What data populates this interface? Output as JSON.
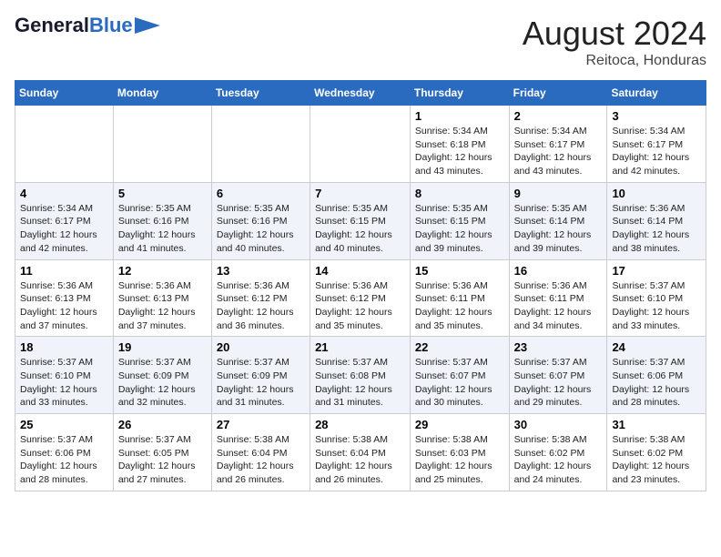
{
  "header": {
    "logo_line1": "General",
    "logo_line2": "Blue",
    "month": "August 2024",
    "location": "Reitoca, Honduras"
  },
  "days_of_week": [
    "Sunday",
    "Monday",
    "Tuesday",
    "Wednesday",
    "Thursday",
    "Friday",
    "Saturday"
  ],
  "weeks": [
    [
      {
        "day": "",
        "info": ""
      },
      {
        "day": "",
        "info": ""
      },
      {
        "day": "",
        "info": ""
      },
      {
        "day": "",
        "info": ""
      },
      {
        "day": "1",
        "info": "Sunrise: 5:34 AM\nSunset: 6:18 PM\nDaylight: 12 hours\nand 43 minutes."
      },
      {
        "day": "2",
        "info": "Sunrise: 5:34 AM\nSunset: 6:17 PM\nDaylight: 12 hours\nand 43 minutes."
      },
      {
        "day": "3",
        "info": "Sunrise: 5:34 AM\nSunset: 6:17 PM\nDaylight: 12 hours\nand 42 minutes."
      }
    ],
    [
      {
        "day": "4",
        "info": "Sunrise: 5:34 AM\nSunset: 6:17 PM\nDaylight: 12 hours\nand 42 minutes."
      },
      {
        "day": "5",
        "info": "Sunrise: 5:35 AM\nSunset: 6:16 PM\nDaylight: 12 hours\nand 41 minutes."
      },
      {
        "day": "6",
        "info": "Sunrise: 5:35 AM\nSunset: 6:16 PM\nDaylight: 12 hours\nand 40 minutes."
      },
      {
        "day": "7",
        "info": "Sunrise: 5:35 AM\nSunset: 6:15 PM\nDaylight: 12 hours\nand 40 minutes."
      },
      {
        "day": "8",
        "info": "Sunrise: 5:35 AM\nSunset: 6:15 PM\nDaylight: 12 hours\nand 39 minutes."
      },
      {
        "day": "9",
        "info": "Sunrise: 5:35 AM\nSunset: 6:14 PM\nDaylight: 12 hours\nand 39 minutes."
      },
      {
        "day": "10",
        "info": "Sunrise: 5:36 AM\nSunset: 6:14 PM\nDaylight: 12 hours\nand 38 minutes."
      }
    ],
    [
      {
        "day": "11",
        "info": "Sunrise: 5:36 AM\nSunset: 6:13 PM\nDaylight: 12 hours\nand 37 minutes."
      },
      {
        "day": "12",
        "info": "Sunrise: 5:36 AM\nSunset: 6:13 PM\nDaylight: 12 hours\nand 37 minutes."
      },
      {
        "day": "13",
        "info": "Sunrise: 5:36 AM\nSunset: 6:12 PM\nDaylight: 12 hours\nand 36 minutes."
      },
      {
        "day": "14",
        "info": "Sunrise: 5:36 AM\nSunset: 6:12 PM\nDaylight: 12 hours\nand 35 minutes."
      },
      {
        "day": "15",
        "info": "Sunrise: 5:36 AM\nSunset: 6:11 PM\nDaylight: 12 hours\nand 35 minutes."
      },
      {
        "day": "16",
        "info": "Sunrise: 5:36 AM\nSunset: 6:11 PM\nDaylight: 12 hours\nand 34 minutes."
      },
      {
        "day": "17",
        "info": "Sunrise: 5:37 AM\nSunset: 6:10 PM\nDaylight: 12 hours\nand 33 minutes."
      }
    ],
    [
      {
        "day": "18",
        "info": "Sunrise: 5:37 AM\nSunset: 6:10 PM\nDaylight: 12 hours\nand 33 minutes."
      },
      {
        "day": "19",
        "info": "Sunrise: 5:37 AM\nSunset: 6:09 PM\nDaylight: 12 hours\nand 32 minutes."
      },
      {
        "day": "20",
        "info": "Sunrise: 5:37 AM\nSunset: 6:09 PM\nDaylight: 12 hours\nand 31 minutes."
      },
      {
        "day": "21",
        "info": "Sunrise: 5:37 AM\nSunset: 6:08 PM\nDaylight: 12 hours\nand 31 minutes."
      },
      {
        "day": "22",
        "info": "Sunrise: 5:37 AM\nSunset: 6:07 PM\nDaylight: 12 hours\nand 30 minutes."
      },
      {
        "day": "23",
        "info": "Sunrise: 5:37 AM\nSunset: 6:07 PM\nDaylight: 12 hours\nand 29 minutes."
      },
      {
        "day": "24",
        "info": "Sunrise: 5:37 AM\nSunset: 6:06 PM\nDaylight: 12 hours\nand 28 minutes."
      }
    ],
    [
      {
        "day": "25",
        "info": "Sunrise: 5:37 AM\nSunset: 6:06 PM\nDaylight: 12 hours\nand 28 minutes."
      },
      {
        "day": "26",
        "info": "Sunrise: 5:37 AM\nSunset: 6:05 PM\nDaylight: 12 hours\nand 27 minutes."
      },
      {
        "day": "27",
        "info": "Sunrise: 5:38 AM\nSunset: 6:04 PM\nDaylight: 12 hours\nand 26 minutes."
      },
      {
        "day": "28",
        "info": "Sunrise: 5:38 AM\nSunset: 6:04 PM\nDaylight: 12 hours\nand 26 minutes."
      },
      {
        "day": "29",
        "info": "Sunrise: 5:38 AM\nSunset: 6:03 PM\nDaylight: 12 hours\nand 25 minutes."
      },
      {
        "day": "30",
        "info": "Sunrise: 5:38 AM\nSunset: 6:02 PM\nDaylight: 12 hours\nand 24 minutes."
      },
      {
        "day": "31",
        "info": "Sunrise: 5:38 AM\nSunset: 6:02 PM\nDaylight: 12 hours\nand 23 minutes."
      }
    ]
  ]
}
